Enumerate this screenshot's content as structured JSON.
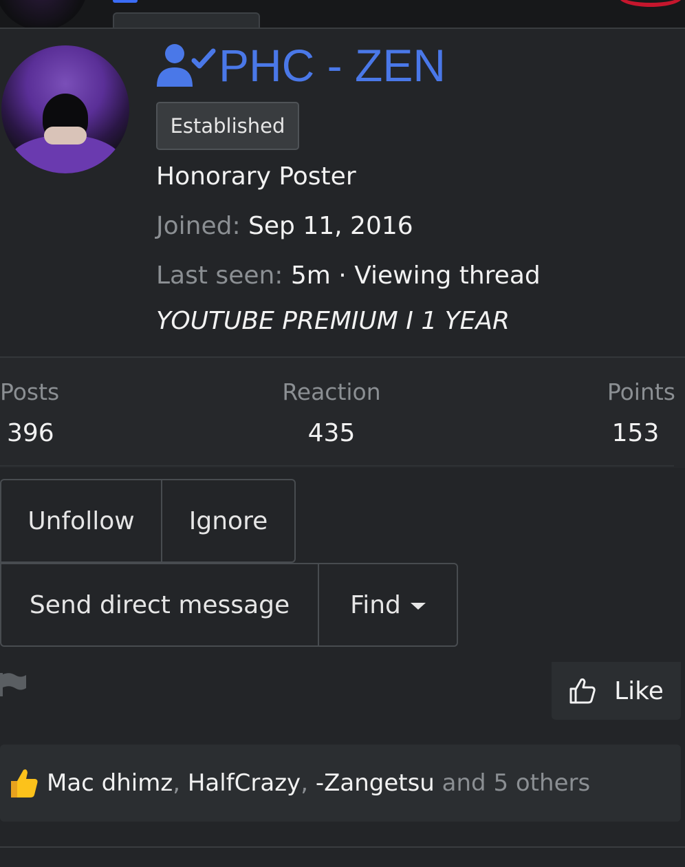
{
  "profile": {
    "username": "PHC - ZEN",
    "badge": "Established",
    "title": "Honorary Poster",
    "joined_label": "Joined:",
    "joined_value": "Sep 11, 2016",
    "last_seen_label": "Last seen:",
    "last_seen_value": "5m · Viewing thread",
    "custom_title": "YOUTUBE PREMIUM I 1 YEAR"
  },
  "stats": {
    "posts_label": "Posts",
    "posts_value": "396",
    "reaction_label": "Reaction",
    "reaction_value": "435",
    "points_label": "Points",
    "points_value": "153"
  },
  "actions": {
    "unfollow": "Unfollow",
    "ignore": "Ignore",
    "send_message": "Send direct message",
    "find": "Find"
  },
  "post": {
    "like_label": "Like",
    "reactions": {
      "user1": "Mac dhimz",
      "sep1": ",",
      "user2": "HalfCrazy",
      "sep2": ",",
      "user3": "-Zangetsu",
      "others": "and 5 others"
    }
  },
  "colors": {
    "accent": "#4a78e8",
    "background": "#232528",
    "muted_text": "#8b8f93"
  },
  "icons": {
    "user_check": "user-check-icon",
    "flag": "flag-icon",
    "like": "thumbs-up-icon",
    "reaction_emoji": "thumbs-up-emoji-icon",
    "dropdown": "caret-down-icon"
  }
}
